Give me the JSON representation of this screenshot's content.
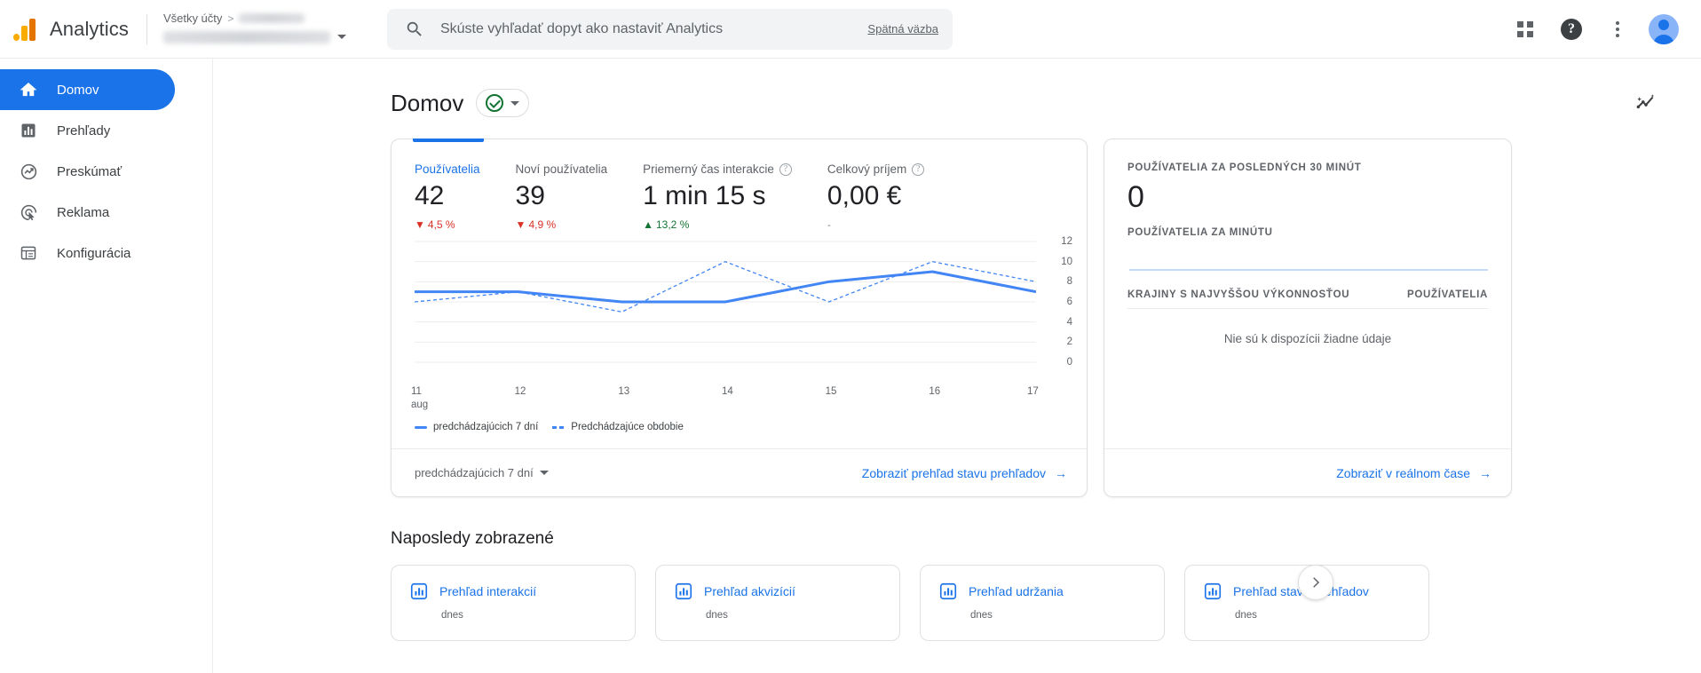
{
  "header": {
    "brand": "Analytics",
    "breadcrumb": {
      "all_accounts": "Všetky účty",
      "separator": ">"
    },
    "search": {
      "placeholder": "Skúste vyhľadať dopyt ako nastaviť Analytics",
      "feedback_label": "Spätná väzba"
    },
    "icons": {
      "apps": "apps-grid-icon",
      "help": "?",
      "more": "more-vert-icon",
      "account": "avatar"
    }
  },
  "sidebar": {
    "items": [
      {
        "label": "Domov",
        "icon": "home-icon",
        "active": true
      },
      {
        "label": "Prehľady",
        "icon": "reports-bar-chart-icon",
        "active": false
      },
      {
        "label": "Preskúmať",
        "icon": "explore-icon",
        "active": false
      },
      {
        "label": "Reklama",
        "icon": "advertising-icon",
        "active": false
      },
      {
        "label": "Konfigurácia",
        "icon": "configure-table-icon",
        "active": false
      }
    ]
  },
  "page": {
    "title": "Domov",
    "status_icon": "green-check-circle-icon",
    "insights_icon": "insights-sparkle-icon"
  },
  "overview_card": {
    "metrics": [
      {
        "label": "Používatelia",
        "value": "42",
        "delta": "4,5 %",
        "direction": "down",
        "active": true,
        "has_help": false
      },
      {
        "label": "Noví používatelia",
        "value": "39",
        "delta": "4,9 %",
        "direction": "down",
        "active": false,
        "has_help": false
      },
      {
        "label": "Priemerný čas interakcie",
        "value": "1 min 15 s",
        "delta": "13,2 %",
        "direction": "up",
        "active": false,
        "has_help": true
      },
      {
        "label": "Celkový príjem",
        "value": "0,00 €",
        "delta": "-",
        "direction": "none",
        "active": false,
        "has_help": true
      }
    ],
    "date_range": "predchádzajúcich 7 dní",
    "footer_link": "Zobraziť prehľad stavu prehľadov"
  },
  "realtime_card": {
    "title": "POUŽÍVATELIA ZA POSLEDNÝCH 30 MINÚT",
    "value": "0",
    "subtitle": "POUŽÍVATELIA ZA MINÚTU",
    "table_head_left": "KRAJINY S NAJVYŠŠOU VÝKONNOSŤOU",
    "table_head_right": "POUŽÍVATELIA",
    "no_data": "Nie sú k dispozícii žiadne údaje",
    "footer_link": "Zobraziť v reálnom čase"
  },
  "recent": {
    "title": "Naposledy zobrazené",
    "cards": [
      {
        "label": "Prehľad interakcií",
        "sub": "dnes",
        "icon": "bar-chart-icon"
      },
      {
        "label": "Prehľad akvizícií",
        "sub": "dnes",
        "icon": "bar-chart-icon"
      },
      {
        "label": "Prehľad udržania",
        "sub": "dnes",
        "icon": "bar-chart-icon"
      },
      {
        "label": "Prehľad stavu prehľadov",
        "sub": "dnes",
        "icon": "bar-chart-icon"
      }
    ]
  },
  "colors": {
    "accent": "#1a73e8",
    "line": "#4285f4",
    "down": "#d93025",
    "up": "#137333",
    "logo_orange": "#f9ab00",
    "logo_dark_orange": "#e37400"
  },
  "chart_data": {
    "type": "line",
    "title": "",
    "xlabel": "",
    "ylabel": "",
    "x": [
      "11",
      "12",
      "13",
      "14",
      "15",
      "16",
      "17"
    ],
    "x_sub_label": "aug",
    "ylim": [
      0,
      12
    ],
    "yticks": [
      0,
      2,
      4,
      6,
      8,
      10,
      12
    ],
    "grid": true,
    "legend_position": "bottom-left",
    "series": [
      {
        "name": "predchádzajúcich 7 dní",
        "style": "solid",
        "values": [
          7,
          7,
          6,
          6,
          8,
          9,
          7
        ]
      },
      {
        "name": "Predchádzajúce obdobie",
        "style": "dashed",
        "values": [
          6,
          7,
          5,
          10,
          6,
          10,
          8
        ]
      }
    ]
  },
  "realtime_sparkline": {
    "type": "bar",
    "values": [
      0,
      0,
      0,
      0,
      0,
      0,
      0,
      0,
      0,
      0,
      0,
      0,
      0,
      0,
      0,
      0,
      0,
      0,
      0,
      0,
      0,
      0,
      0,
      0,
      0,
      0,
      0,
      0,
      0,
      0
    ]
  }
}
